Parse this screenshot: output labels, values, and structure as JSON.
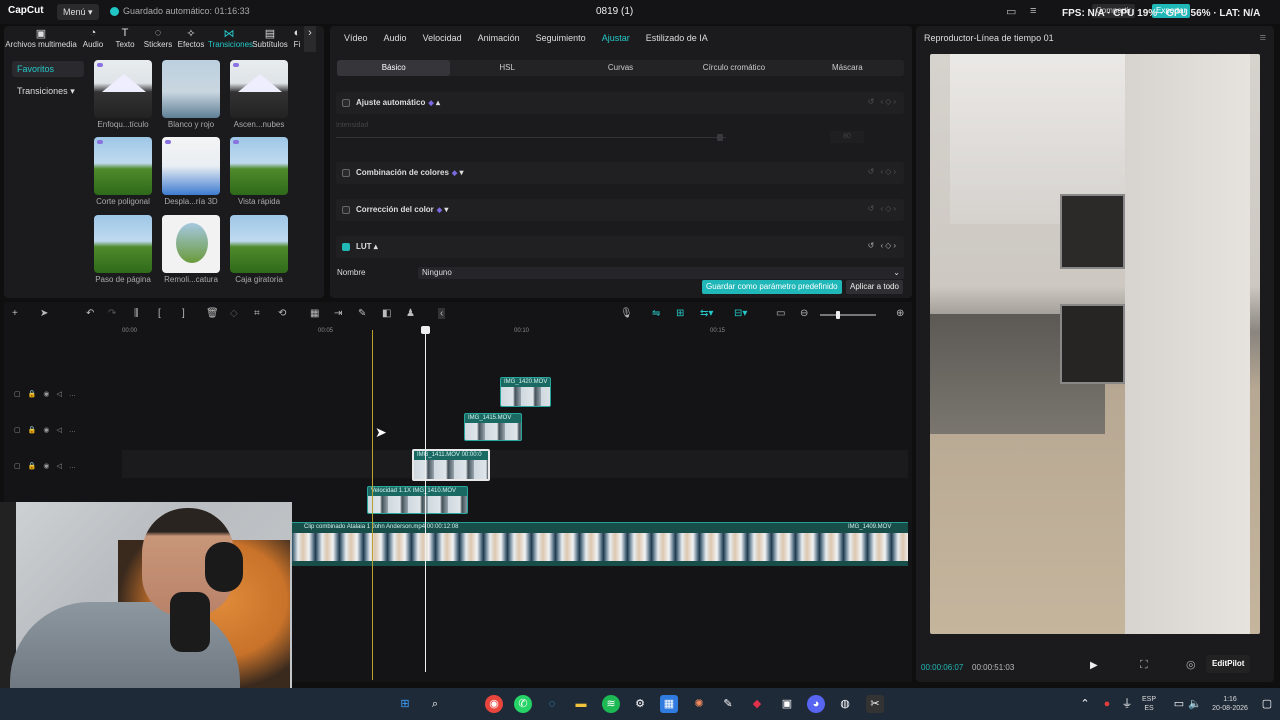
{
  "titlebar": {
    "logo": "CapCut",
    "menu": "Menú",
    "autosave": "Guardado automático: 01:16:33",
    "project_title": "0819 (1)",
    "stats": "FPS: N/A · CPU 19% · GPU 56% · LAT: N/A",
    "btn_share": "Compartir",
    "btn_export": "Exportar"
  },
  "media_tabs": [
    {
      "label": "Archivos multimedia",
      "icon": "import-icon"
    },
    {
      "label": "Audio",
      "icon": "audio-icon"
    },
    {
      "label": "Texto",
      "icon": "text-icon"
    },
    {
      "label": "Stickers",
      "icon": "sticker-icon"
    },
    {
      "label": "Efectos",
      "icon": "effects-icon"
    },
    {
      "label": "Transiciones",
      "icon": "transitions-icon",
      "active": true
    },
    {
      "label": "Subtítulos",
      "icon": "subtitles-icon"
    },
    {
      "label": "Fi",
      "icon": "filters-icon"
    }
  ],
  "sidebar": {
    "favorites": "Favoritos",
    "transitions": "Transiciones"
  },
  "transitions": [
    {
      "label": "Enfoqu...tículo",
      "style": "mountain"
    },
    {
      "label": "Blanco y rojo",
      "style": "tower"
    },
    {
      "label": "Ascen...nubes",
      "style": "mountain"
    },
    {
      "label": "Corte poligonal",
      "style": "field"
    },
    {
      "label": "Despla...ría 3D",
      "style": "white"
    },
    {
      "label": "Vista rápida",
      "style": "field"
    },
    {
      "label": "Paso de página",
      "style": "field"
    },
    {
      "label": "Remoli...catura",
      "style": "circle"
    },
    {
      "label": "Caja giratoria",
      "style": "field"
    }
  ],
  "adjust": {
    "tabs": [
      "Vídeo",
      "Audio",
      "Velocidad",
      "Animación",
      "Seguimiento",
      "Ajustar",
      "Estilizado de IA"
    ],
    "active_tab": "Ajustar",
    "subtabs": [
      "Básico",
      "HSL",
      "Curvas",
      "Círculo cromático",
      "Máscara"
    ],
    "active_subtab": "Básico",
    "auto_adjust": "Ajuste automático",
    "intensity": "Intensidad",
    "intensity_value": "80",
    "color_combo": "Combinación de colores",
    "color_correction": "Corrección del color",
    "lut": "LUT",
    "name_label": "Nombre",
    "name_value": "Ninguno",
    "save_preset": "Guardar como parámetro predefinido",
    "apply_all": "Aplicar a todo"
  },
  "player": {
    "title": "Reproductor-Línea de tiempo 01",
    "time_current": "00:00:06:07",
    "time_total": "00:00:51:03",
    "editpilot": "EditPilot"
  },
  "timeline": {
    "ruler": [
      "00:00",
      "00:05",
      "00:10",
      "00:15"
    ],
    "clips": [
      {
        "label": "IMG_1420.MOV"
      },
      {
        "label": "IMG_1415.MOV"
      },
      {
        "label": "IMG_1411.MOV  00:00:0"
      },
      {
        "label": "Velocidad 1.1X  IMG_1410.MOV"
      }
    ],
    "main_clip_label": "Clip combinado  Atalaia 1 John Anderson.mp4  00:00:12:08",
    "main_clip_tail": "IMG_1409.MOV"
  },
  "taskbar": {
    "lang": "ESP",
    "lang2": "ES",
    "time": "1:16",
    "date": "20-08-2026"
  }
}
